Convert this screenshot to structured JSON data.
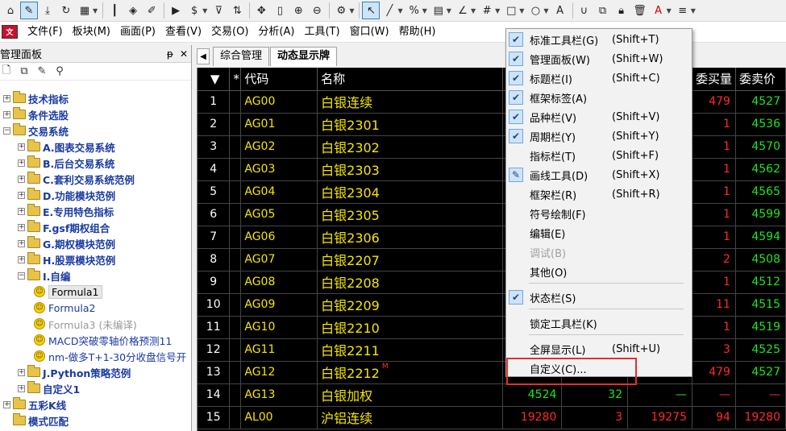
{
  "toolbar": {
    "buttons": [
      "home-icon",
      "pencil-icon",
      "download-icon",
      "refresh-icon",
      "grid-icon",
      "candlestick-icon",
      "diamond-icon",
      "edit-icon",
      "play-icon",
      "dollar-icon",
      "filter-icon",
      "swap-icon",
      "move-icon",
      "bar-icon",
      "zoom-in-icon",
      "zoom-out-icon",
      "gear-icon",
      "cursor-icon",
      "line-icon",
      "percent-icon",
      "ruler-icon",
      "angle-icon",
      "hash-icon",
      "rect-icon",
      "circle-icon",
      "text-icon",
      "magnet-icon",
      "copy-icon",
      "lock-icon",
      "trash-icon",
      "color-icon",
      "line-style-icon"
    ]
  },
  "menubar": {
    "items": [
      "文件(F)",
      "板块(M)",
      "画面(P)",
      "查看(V)",
      "交易(O)",
      "分析(A)",
      "工具(T)",
      "窗口(W)",
      "帮助(H)"
    ]
  },
  "panel": {
    "title": "管理面板",
    "pin": "ᵽ",
    "close": "✕"
  },
  "tree": {
    "items": [
      {
        "label": "技术指标",
        "level": 0,
        "type": "folder",
        "expander": "+"
      },
      {
        "label": "条件选股",
        "level": 0,
        "type": "folder",
        "expander": "+"
      },
      {
        "label": "交易系统",
        "level": 0,
        "type": "folder",
        "expander": "−"
      },
      {
        "label": "A.图表交易系统",
        "level": 1,
        "type": "folder",
        "expander": "+"
      },
      {
        "label": "B.后台交易系统",
        "level": 1,
        "type": "folder",
        "expander": "+"
      },
      {
        "label": "C.套利交易系统范例",
        "level": 1,
        "type": "folder",
        "expander": "+"
      },
      {
        "label": "D.功能模块范例",
        "level": 1,
        "type": "folder",
        "expander": "+"
      },
      {
        "label": "E.专用特色指标",
        "level": 1,
        "type": "folder",
        "expander": "+"
      },
      {
        "label": "F.gsf期权组合",
        "level": 1,
        "type": "folder",
        "expander": "+"
      },
      {
        "label": "G.期权模块范例",
        "level": 1,
        "type": "folder",
        "expander": "+"
      },
      {
        "label": "H.股票模块范例",
        "level": 1,
        "type": "folder",
        "expander": "+"
      },
      {
        "label": "I.自编",
        "level": 1,
        "type": "folder",
        "expander": "−"
      },
      {
        "label": "Formula1",
        "level": 2,
        "type": "smiley",
        "style": "sel"
      },
      {
        "label": "Formula2",
        "level": 2,
        "type": "smiley",
        "style": "plain"
      },
      {
        "label": "Formula3 (未编译)",
        "level": 2,
        "type": "smiley",
        "style": "gray"
      },
      {
        "label": "MACD突破零轴价格预测11",
        "level": 2,
        "type": "smiley",
        "style": "plain"
      },
      {
        "label": "nm-做多T+1-30分收盘信号开",
        "level": 2,
        "type": "smiley",
        "style": "plain"
      },
      {
        "label": "J.Python策略范例",
        "level": 1,
        "type": "folder",
        "expander": "+"
      },
      {
        "label": "自定义1",
        "level": 1,
        "type": "folder",
        "expander": "+"
      },
      {
        "label": "五彩K线",
        "level": 0,
        "type": "folder",
        "expander": "+"
      },
      {
        "label": "模式匹配",
        "level": 0,
        "type": "folder",
        "expander": ""
      }
    ]
  },
  "tabs": {
    "arrow": "◀",
    "items": [
      "综合管理",
      "动态显示牌"
    ]
  },
  "grid": {
    "headers": [
      "▼",
      "*",
      "代码",
      "名称",
      "",
      "",
      "",
      "委买量",
      "委卖价"
    ],
    "rows": [
      {
        "i": "1",
        "code": "AG00",
        "name": "白银连续",
        "c5": "",
        "c6": "",
        "c7": "",
        "buy_vol": "479",
        "sell_price": "4527"
      },
      {
        "i": "2",
        "code": "AG01",
        "name": "白银2301",
        "c5": "",
        "c6": "",
        "c7": "",
        "buy_vol": "1",
        "sell_price": "4536"
      },
      {
        "i": "3",
        "code": "AG02",
        "name": "白银2302",
        "c5": "",
        "c6": "",
        "c7": "",
        "buy_vol": "1",
        "sell_price": "4570"
      },
      {
        "i": "4",
        "code": "AG03",
        "name": "白银2303",
        "c5": "",
        "c6": "",
        "c7": "",
        "buy_vol": "1",
        "sell_price": "4562"
      },
      {
        "i": "5",
        "code": "AG04",
        "name": "白银2304",
        "c5": "",
        "c6": "",
        "c7": "",
        "buy_vol": "1",
        "sell_price": "4565"
      },
      {
        "i": "6",
        "code": "AG05",
        "name": "白银2305",
        "c5": "",
        "c6": "",
        "c7": "",
        "buy_vol": "1",
        "sell_price": "4599"
      },
      {
        "i": "7",
        "code": "AG06",
        "name": "白银2306",
        "c5": "",
        "c6": "",
        "c7": "",
        "buy_vol": "1",
        "sell_price": "4594"
      },
      {
        "i": "8",
        "code": "AG07",
        "name": "白银2207",
        "c5": "",
        "c6": "",
        "c7": "",
        "buy_vol": "2",
        "sell_price": "4508"
      },
      {
        "i": "9",
        "code": "AG08",
        "name": "白银2208",
        "c5": "",
        "c6": "",
        "c7": "",
        "buy_vol": "1",
        "sell_price": "4512"
      },
      {
        "i": "10",
        "code": "AG09",
        "name": "白银2209",
        "c5": "",
        "c6": "",
        "c7": "",
        "buy_vol": "11",
        "sell_price": "4515"
      },
      {
        "i": "11",
        "code": "AG10",
        "name": "白银2210",
        "c5": "",
        "c6": "",
        "c7": "",
        "buy_vol": "1",
        "sell_price": "4519"
      },
      {
        "i": "12",
        "code": "AG11",
        "name": "白银2211",
        "c5": "",
        "c6": "",
        "c7": "",
        "buy_vol": "3",
        "sell_price": "4525"
      },
      {
        "i": "13",
        "code": "AG12",
        "name": "白银2212",
        "c5": "",
        "c6": "",
        "c7": "",
        "buy_vol": "479",
        "sell_price": "4527"
      },
      {
        "i": "14",
        "code": "AG13",
        "name": "白银加权",
        "c5": "4524",
        "c6": "32",
        "c7": "—",
        "buy_vol": "—",
        "sell_price": "—"
      },
      {
        "i": "15",
        "code": "AL00",
        "name": "沪铝连续",
        "c5": "19280",
        "c6": "3",
        "c7": "19275",
        "buy_vol": "94",
        "sell_price": "19280"
      }
    ],
    "flag_row": 13,
    "flag_text": "M"
  },
  "context_menu": {
    "items": [
      {
        "label": "标准工具栏(G)",
        "shortcut": "(Shift+T)",
        "checked": true
      },
      {
        "label": "管理面板(W)",
        "shortcut": "(Shift+W)",
        "checked": true
      },
      {
        "label": "标题栏(I)",
        "shortcut": "(Shift+C)",
        "checked": true
      },
      {
        "label": "框架标签(A)",
        "shortcut": "",
        "checked": true
      },
      {
        "label": "品种栏(V)",
        "shortcut": "(Shift+V)",
        "checked": true
      },
      {
        "label": "周期栏(Y)",
        "shortcut": "(Shift+Y)",
        "checked": true
      },
      {
        "label": "指标栏(T)",
        "shortcut": "(Shift+F)",
        "checked": false
      },
      {
        "label": "画线工具(D)",
        "shortcut": "(Shift+X)",
        "checked": false,
        "icon": "✎"
      },
      {
        "label": "框架栏(R)",
        "shortcut": "(Shift+R)",
        "checked": false
      },
      {
        "label": "符号绘制(F)",
        "shortcut": "",
        "checked": false
      },
      {
        "label": "编辑(E)",
        "shortcut": "",
        "checked": false
      },
      {
        "label": "调试(B)",
        "shortcut": "",
        "checked": false,
        "disabled": true
      },
      {
        "label": "其他(O)",
        "shortcut": "",
        "checked": false
      },
      {
        "label": "状态栏(S)",
        "shortcut": "",
        "checked": true
      },
      {
        "label": "锁定工具栏(K)",
        "shortcut": "",
        "checked": false
      },
      {
        "label": "全屏显示(L)",
        "shortcut": "(Shift+U)",
        "checked": false
      },
      {
        "label": "自定义(C)...",
        "shortcut": "",
        "checked": false
      }
    ],
    "check_glyph": "✔"
  },
  "colors": {
    "grid_bg": "#000000",
    "text_yellow": "#f5e600",
    "up_red": "#ff2a2a",
    "down_green": "#1ee61e",
    "highlight": "#e03030"
  }
}
